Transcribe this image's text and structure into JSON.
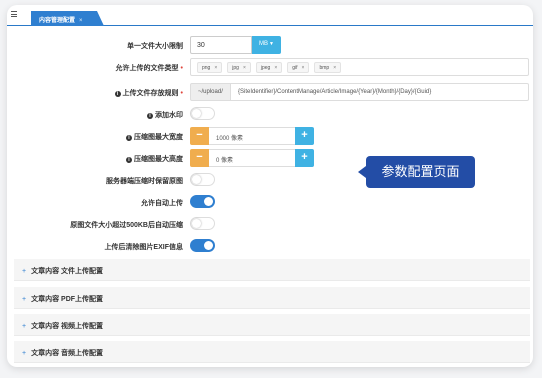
{
  "tab": {
    "label": "内容管理配置",
    "close": "×"
  },
  "form": {
    "max_file_size": {
      "label": "单一文件大小限制",
      "value": "30",
      "unit": "MB"
    },
    "allowed_types": {
      "label": "允许上传的文件类型",
      "tags": [
        "png",
        "jpg",
        "jpeg",
        "gif",
        "bmp"
      ]
    },
    "storage_rule": {
      "label": "上传文件存放规则",
      "prefix": "~/upload/",
      "value": "{SiteIdentifier}/ContentManage/Article/Image/{Year}/{Month}/{Day}/{Guid}"
    },
    "watermark": {
      "label": "添加水印",
      "on": false
    },
    "max_width": {
      "label": "压缩图最大宽度",
      "value": "1000 像素",
      "minus": "−",
      "plus": "+"
    },
    "max_height": {
      "label": "压缩图最大高度",
      "value": "0 像素",
      "minus": "−",
      "plus": "+"
    },
    "keep_original": {
      "label": "服务器端压缩时保留原图",
      "on": false
    },
    "auto_upload": {
      "label": "允许自动上传",
      "on": true
    },
    "auto_compress": {
      "label": "原图文件大小超过500KB后自动压缩",
      "on": false
    },
    "clear_exif": {
      "label": "上传后清除图片EXIF信息",
      "on": true
    }
  },
  "callout": {
    "text": "参数配置页面"
  },
  "sections": [
    {
      "label": "文章内容 文件上传配置"
    },
    {
      "label": "文章内容 PDF上传配置"
    },
    {
      "label": "文章内容 视频上传配置"
    },
    {
      "label": "文章内容 音频上传配置"
    }
  ],
  "colors": {
    "primary": "#2f7fd0",
    "info": "#3fb2e3",
    "warning": "#f0ad4e",
    "callout": "#234da6",
    "required": "#e0463c"
  }
}
